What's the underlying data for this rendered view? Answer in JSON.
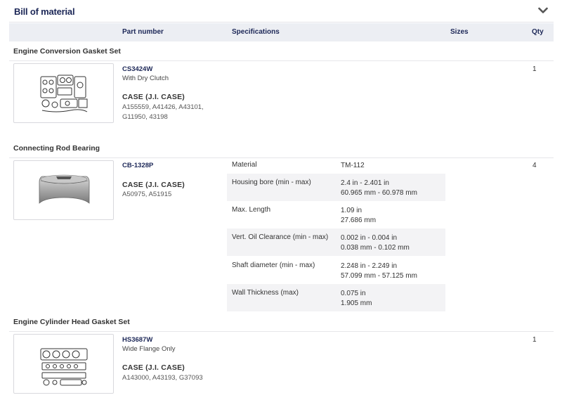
{
  "header": {
    "title": "Bill of material",
    "collapse_icon": "chevron-down-icon"
  },
  "columns": {
    "part_number": "Part number",
    "specifications": "Specifications",
    "sizes": "Sizes",
    "qty": "Qty"
  },
  "items": [
    {
      "group": "Engine Conversion Gasket Set",
      "part_number": "CS3424W",
      "description": "With Dry Clutch",
      "brand": "CASE (J.I. CASE)",
      "references": "A155559, A41426, A43101, G11950, 43198",
      "qty": "1",
      "image": "conversion-gasket-set-image"
    },
    {
      "group": "Connecting Rod Bearing",
      "part_number": "CB-1328P",
      "brand": "CASE (J.I. CASE)",
      "references": "A50975, A51915",
      "qty": "4",
      "image": "rod-bearing-image",
      "specs": [
        {
          "label": "Material",
          "value1": "TM-112",
          "value2": ""
        },
        {
          "label": "Housing bore (min - max)",
          "value1": "2.4 in - 2.401 in",
          "value2": "60.965 mm - 60.978 mm"
        },
        {
          "label": "Max. Length",
          "value1": "1.09 in",
          "value2": "27.686 mm"
        },
        {
          "label": "Vert. Oil Clearance (min - max)",
          "value1": "0.002 in - 0.004 in",
          "value2": "0.038 mm - 0.102 mm"
        },
        {
          "label": "Shaft diameter (min - max)",
          "value1": "2.248 in - 2.249 in",
          "value2": "57.099 mm - 57.125 mm"
        },
        {
          "label": "Wall Thickness (max)",
          "value1": "0.075 in",
          "value2": "1.905 mm"
        }
      ]
    },
    {
      "group": "Engine Cylinder Head Gasket Set",
      "part_number": "HS3687W",
      "description": "Wide Flange Only",
      "brand": "CASE (J.I. CASE)",
      "references": "A143000, A43193, G37093",
      "qty": "1",
      "image": "head-gasket-set-image"
    }
  ]
}
